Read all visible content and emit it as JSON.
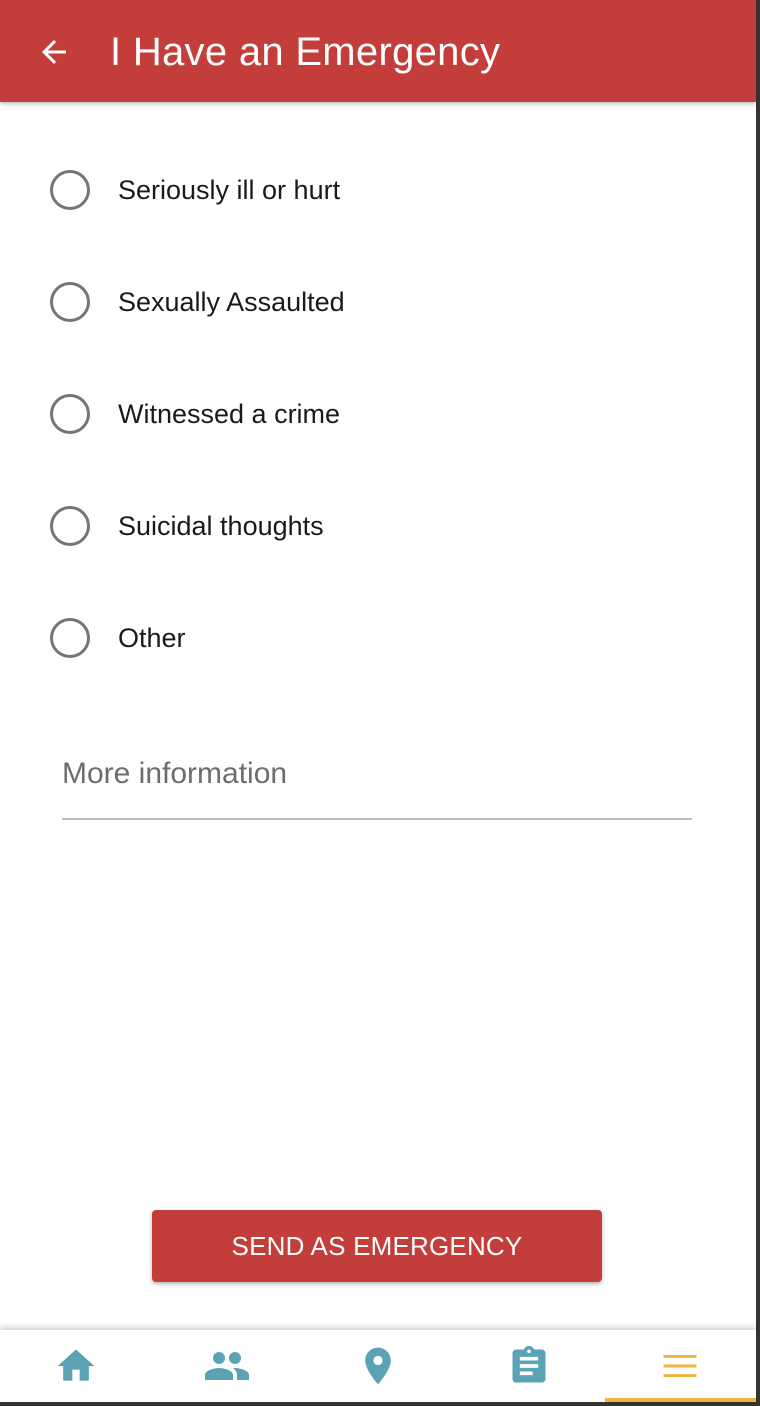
{
  "appbar": {
    "title": "I Have an Emergency",
    "back_icon": "arrow-left-icon",
    "color": "#c33d3a"
  },
  "options": [
    {
      "label": "Seriously ill or hurt",
      "selected": false
    },
    {
      "label": "Sexually Assaulted",
      "selected": false
    },
    {
      "label": "Witnessed a crime",
      "selected": false
    },
    {
      "label": "Suicidal thoughts",
      "selected": false
    },
    {
      "label": "Other",
      "selected": false
    }
  ],
  "more_info": {
    "placeholder": "More information",
    "value": ""
  },
  "send_button": {
    "label": "SEND AS EMERGENCY"
  },
  "bottom_nav": {
    "items": [
      {
        "icon": "home-icon",
        "active": false
      },
      {
        "icon": "people-icon",
        "active": false
      },
      {
        "icon": "location-pin-icon",
        "active": false
      },
      {
        "icon": "clipboard-icon",
        "active": false
      },
      {
        "icon": "menu-icon",
        "active": true
      }
    ],
    "icon_color": "#5ba3b4",
    "active_color": "#f0b43a"
  }
}
